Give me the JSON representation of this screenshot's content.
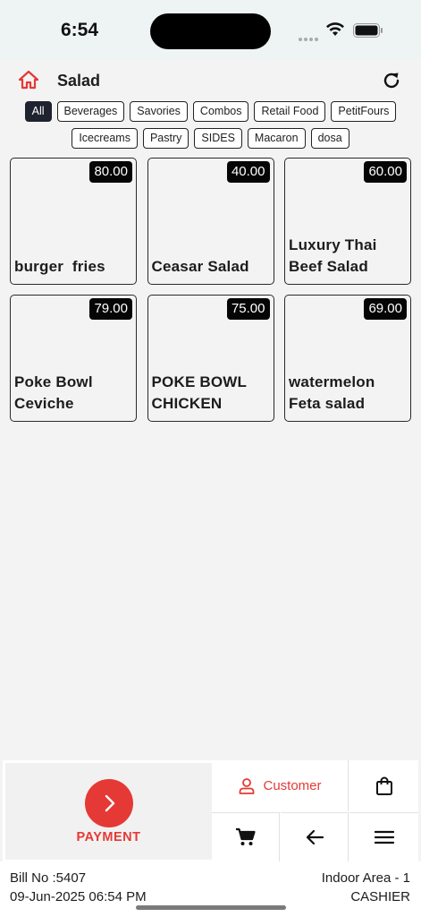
{
  "status_bar": {
    "time": "6:54"
  },
  "header": {
    "title": "Salad",
    "home_icon": "home-icon",
    "refresh_icon": "refresh-icon"
  },
  "categories": [
    {
      "label": "All",
      "active": true
    },
    {
      "label": "Beverages",
      "active": false
    },
    {
      "label": "Savories",
      "active": false
    },
    {
      "label": "Combos",
      "active": false
    },
    {
      "label": "Retail Food",
      "active": false
    },
    {
      "label": "PetitFours",
      "active": false
    },
    {
      "label": "Icecreams",
      "active": false
    },
    {
      "label": "Pastry",
      "active": false
    },
    {
      "label": "SIDES",
      "active": false
    },
    {
      "label": "Macaron",
      "active": false
    },
    {
      "label": "dosa",
      "active": false
    }
  ],
  "products": [
    {
      "name": "burger  fries",
      "price": "80.00"
    },
    {
      "name": "Ceasar Salad",
      "price": "40.00"
    },
    {
      "name": "Luxury Thai\nBeef Salad",
      "price": "60.00"
    },
    {
      "name": "Poke Bowl\nCeviche",
      "price": "79.00"
    },
    {
      "name": "POKE BOWL\nCHICKEN",
      "price": "75.00"
    },
    {
      "name": "watermelon\nFeta salad",
      "price": "69.00"
    }
  ],
  "actions": {
    "payment_label": "PAYMENT",
    "customer_label": "Customer"
  },
  "footer": {
    "bill_no": "Bill No :5407",
    "date": "09-Jun-2025 06:54 PM",
    "area": "Indoor Area - 1",
    "role": "CASHIER"
  },
  "colors": {
    "accent": "#e53935",
    "active_chip": "#1f2330",
    "price_badge": "#050505"
  }
}
